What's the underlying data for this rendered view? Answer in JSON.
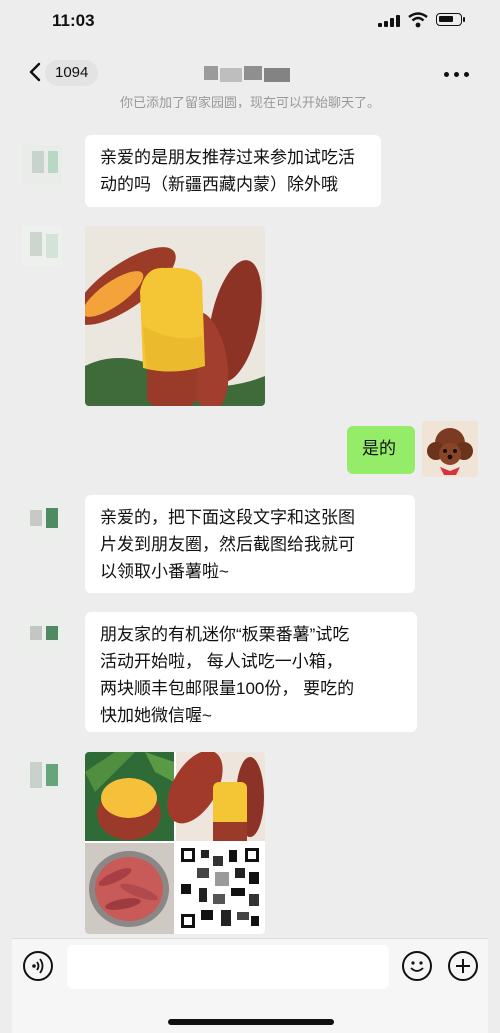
{
  "status_bar": {
    "time": "11:03"
  },
  "nav": {
    "unread_count": "1094"
  },
  "system_message": "你已添加了留家园圆，现在可以开始聊天了。",
  "messages": [
    {
      "side": "left",
      "type": "text",
      "lines": [
        "亲爱的是朋友推荐过来参加试吃活",
        "动的吗（新疆西藏内蒙）除外哦"
      ]
    },
    {
      "side": "left",
      "type": "image",
      "icon": "sweet-potato-photo"
    },
    {
      "side": "right",
      "type": "text",
      "lines": [
        "是的"
      ]
    },
    {
      "side": "left",
      "type": "text",
      "lines": [
        "亲爱的，把下面这段文字和这张图",
        "片发到朋友圈，然后截图给我就可",
        "以领取小番薯啦~"
      ]
    },
    {
      "side": "left",
      "type": "text",
      "lines": [
        "朋友家的有机迷你“板栗番薯”试吃",
        "活动开始啦， 每人试吃一小箱，",
        "两块顺丰包邮限量100份， 要吃的",
        "快加她微信喔~"
      ]
    },
    {
      "side": "left",
      "type": "image-grid",
      "icon": "sweet-potato-collage-with-qr-code"
    }
  ],
  "colors": {
    "bg": "#ededed",
    "bubble_self": "#95ec69",
    "bubble_other": "#ffffff"
  },
  "input_bar": {
    "icons": [
      "voice-icon",
      "emoji-icon",
      "plus-icon"
    ]
  }
}
